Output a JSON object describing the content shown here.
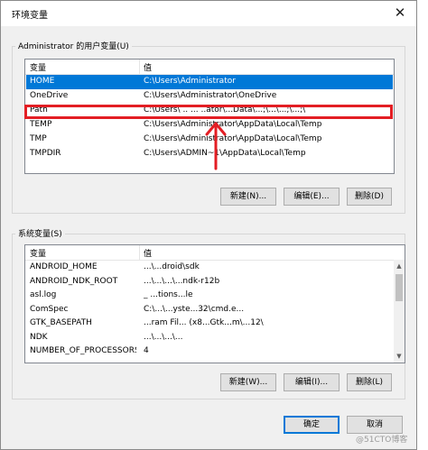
{
  "window": {
    "title": "环境变量",
    "close_glyph": "✕"
  },
  "user_vars": {
    "group_label": "Administrator 的用户变量(U)",
    "headers": {
      "variable": "变量",
      "value": "值"
    },
    "rows": [
      {
        "name": "HOME",
        "value": "C:\\Users\\Administrator",
        "selected": true
      },
      {
        "name": "OneDrive",
        "value": "C:\\Users\\Administrator\\OneDrive"
      },
      {
        "name": "Path",
        "value": "C:\\Users\\ .. ... ..ator\\...Data\\...;\\...\\...;\\...;\\"
      },
      {
        "name": "TEMP",
        "value": "C:\\Users\\Administrator\\AppData\\Local\\Temp"
      },
      {
        "name": "TMP",
        "value": "C:\\Users\\Administrator\\AppData\\Local\\Temp"
      },
      {
        "name": "TMPDIR",
        "value": "C:\\Users\\ADMIN~1\\AppData\\Local\\Temp"
      }
    ],
    "buttons": {
      "new": "新建(N)...",
      "edit": "编辑(E)...",
      "delete": "删除(D)"
    }
  },
  "system_vars": {
    "group_label": "系统变量(S)",
    "headers": {
      "variable": "变量",
      "value": "值"
    },
    "rows": [
      {
        "name": "ANDROID_HOME",
        "value": "...\\...droid\\sdk"
      },
      {
        "name": "ANDROID_NDK_ROOT",
        "value": "...\\...\\...\\...ndk-r12b"
      },
      {
        "name": "asl.log",
        "value": "_ ...tions...le"
      },
      {
        "name": "ComSpec",
        "value": "C:\\...\\...yste...32\\cmd.e..."
      },
      {
        "name": "GTK_BASEPATH",
        "value": "...ram Fil... (x8...Gtk...m\\...12\\"
      },
      {
        "name": "NDK",
        "value": "...\\...\\...\\..."
      },
      {
        "name": "NUMBER_OF_PROCESSORS",
        "value": "4"
      }
    ],
    "buttons": {
      "new": "新建(W)...",
      "edit": "编辑(I)...",
      "delete": "删除(L)"
    }
  },
  "footer": {
    "ok": "确定",
    "cancel": "取消"
  },
  "watermark": "@51CTO博客",
  "colors": {
    "selection": "#0078d7",
    "annotation": "#e31e24"
  }
}
